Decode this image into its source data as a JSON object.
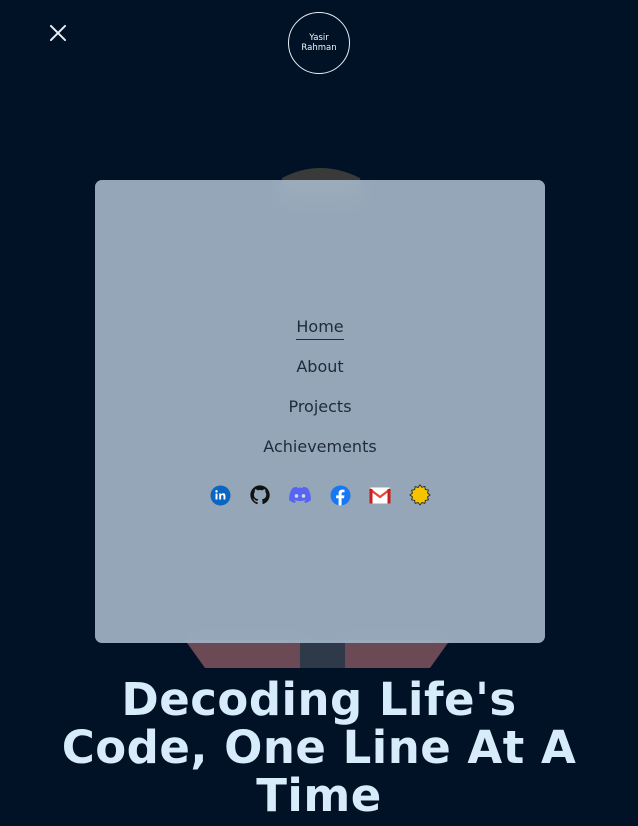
{
  "header": {
    "close_icon": "close-icon",
    "logo_line1": "Yasir",
    "logo_line2": "Rahman"
  },
  "menu": {
    "items": [
      {
        "label": "Home",
        "active": true
      },
      {
        "label": "About",
        "active": false
      },
      {
        "label": "Projects",
        "active": false
      },
      {
        "label": "Achievements",
        "active": false
      }
    ],
    "socials": [
      {
        "icon": "linkedin-icon",
        "color": "#0a66c2"
      },
      {
        "icon": "github-icon",
        "color": "#111111"
      },
      {
        "icon": "discord-icon",
        "color": "#5865f2"
      },
      {
        "icon": "facebook-icon",
        "color": "#1877f2"
      },
      {
        "icon": "gmail-icon",
        "color": "#ea4335"
      },
      {
        "icon": "badge-icon",
        "color": "#f5c400"
      }
    ]
  },
  "hero": {
    "headline_line1": "Decoding Life's",
    "headline_line2": "Code, One Line At A",
    "headline_line3": "Time"
  },
  "colors": {
    "background": "#011226",
    "headline": "#d6ecfb",
    "panel": "#acbfd0"
  }
}
